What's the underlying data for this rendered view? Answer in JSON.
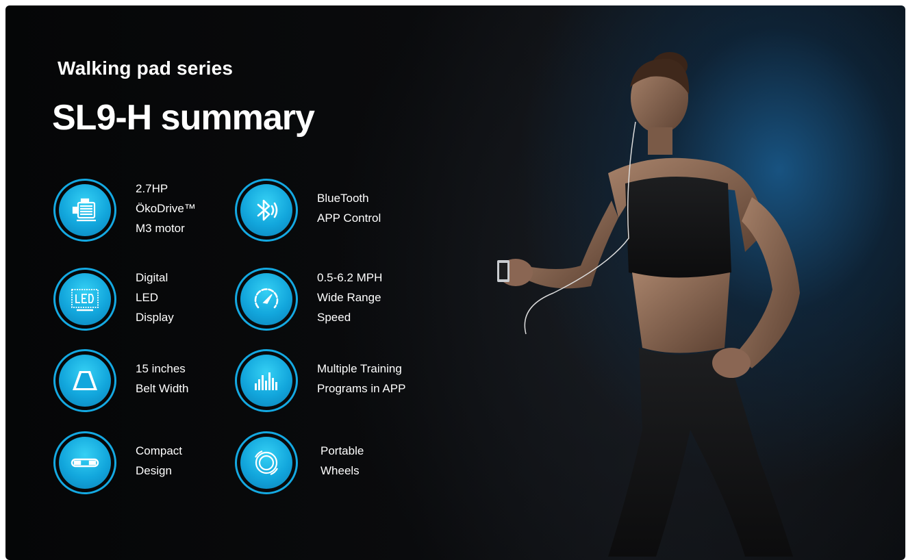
{
  "header": {
    "subtitle": "Walking pad series",
    "title": "SL9-H summary"
  },
  "features": [
    {
      "icon": "motor-icon",
      "lines": [
        "2.7HP",
        "ÖkoDrive™",
        "M3 motor"
      ]
    },
    {
      "icon": "bluetooth-icon",
      "lines": [
        "BlueTooth",
        "APP Control"
      ]
    },
    {
      "icon": "led-display-icon",
      "lines": [
        "Digital",
        "LED",
        "Display"
      ]
    },
    {
      "icon": "speedometer-icon",
      "lines": [
        "0.5-6.2 MPH",
        "Wide Range",
        "Speed"
      ]
    },
    {
      "icon": "belt-width-icon",
      "lines": [
        "15 inches",
        "Belt Width"
      ]
    },
    {
      "icon": "equalizer-icon",
      "lines": [
        "Multiple Training",
        "Programs in APP"
      ]
    },
    {
      "icon": "compact-design-icon",
      "lines": [
        "Compact",
        "Design"
      ]
    },
    {
      "icon": "wheel-icon",
      "lines": [
        "Portable",
        "Wheels"
      ]
    }
  ],
  "colors": {
    "accent": "#14a9e2",
    "icon_fill": "#1fb5e8",
    "background": "#0a0b0d",
    "glow": "#185686"
  }
}
